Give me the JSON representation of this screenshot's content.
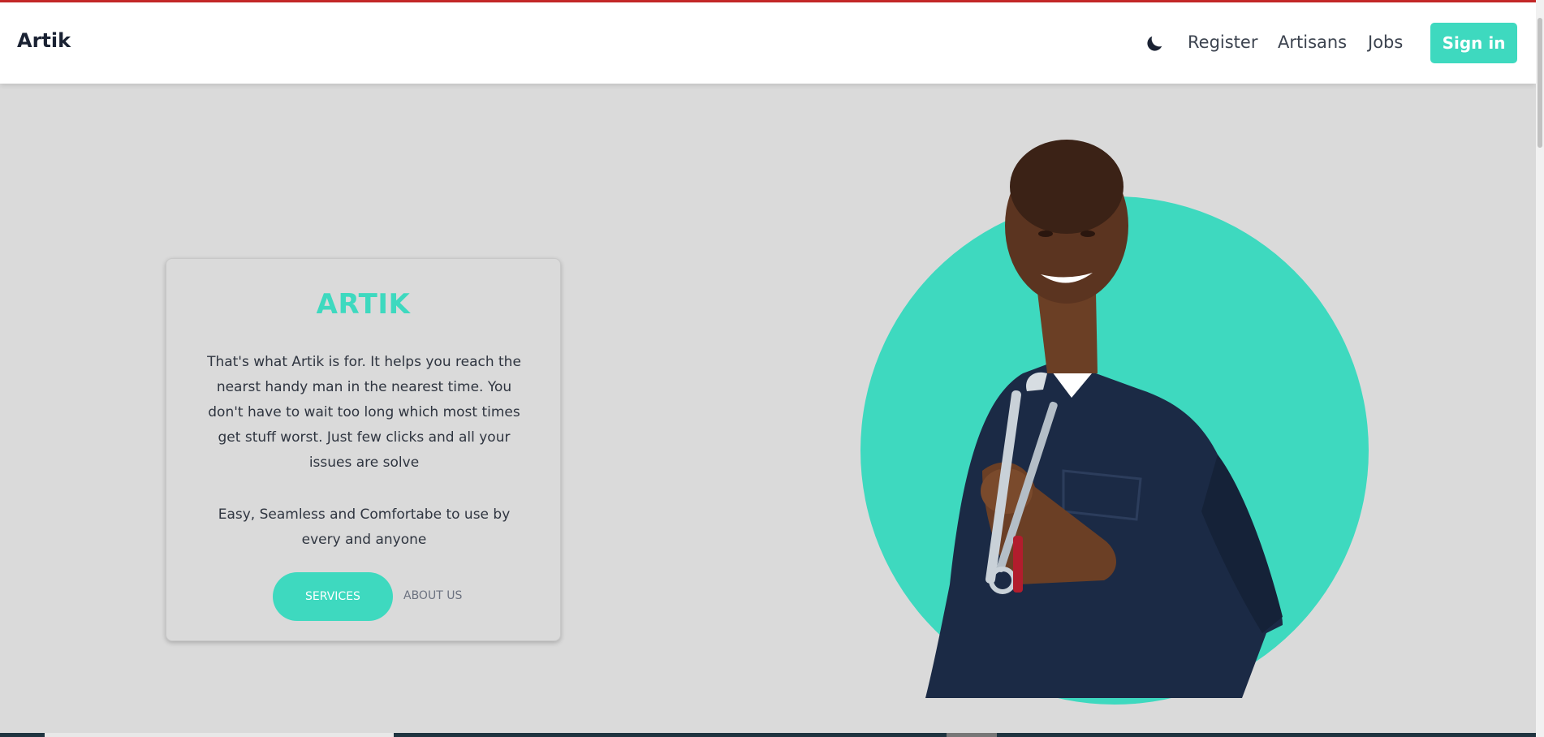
{
  "header": {
    "brand": "Artik",
    "theme_toggle_icon": "moon-icon",
    "nav": {
      "register": "Register",
      "artisans": "Artisans",
      "jobs": "Jobs"
    },
    "signin_label": "Sign in"
  },
  "hero_card": {
    "title": "ARTIK",
    "paragraph1": "That's what Artik is for. It helps you reach the nearst handy man in the nearest time. You don't have to wait too long which most times get stuff worst. Just few clicks and all your issues are solve",
    "paragraph2": "Easy, Seamless and Comfortabe to use by every and anyone",
    "services_label": "SERVICES",
    "about_label": "ABOUT US"
  },
  "colors": {
    "accent": "#3ed9bf",
    "background": "#dadada",
    "top_bar": "#c62828",
    "text_dark": "#1a2233"
  }
}
